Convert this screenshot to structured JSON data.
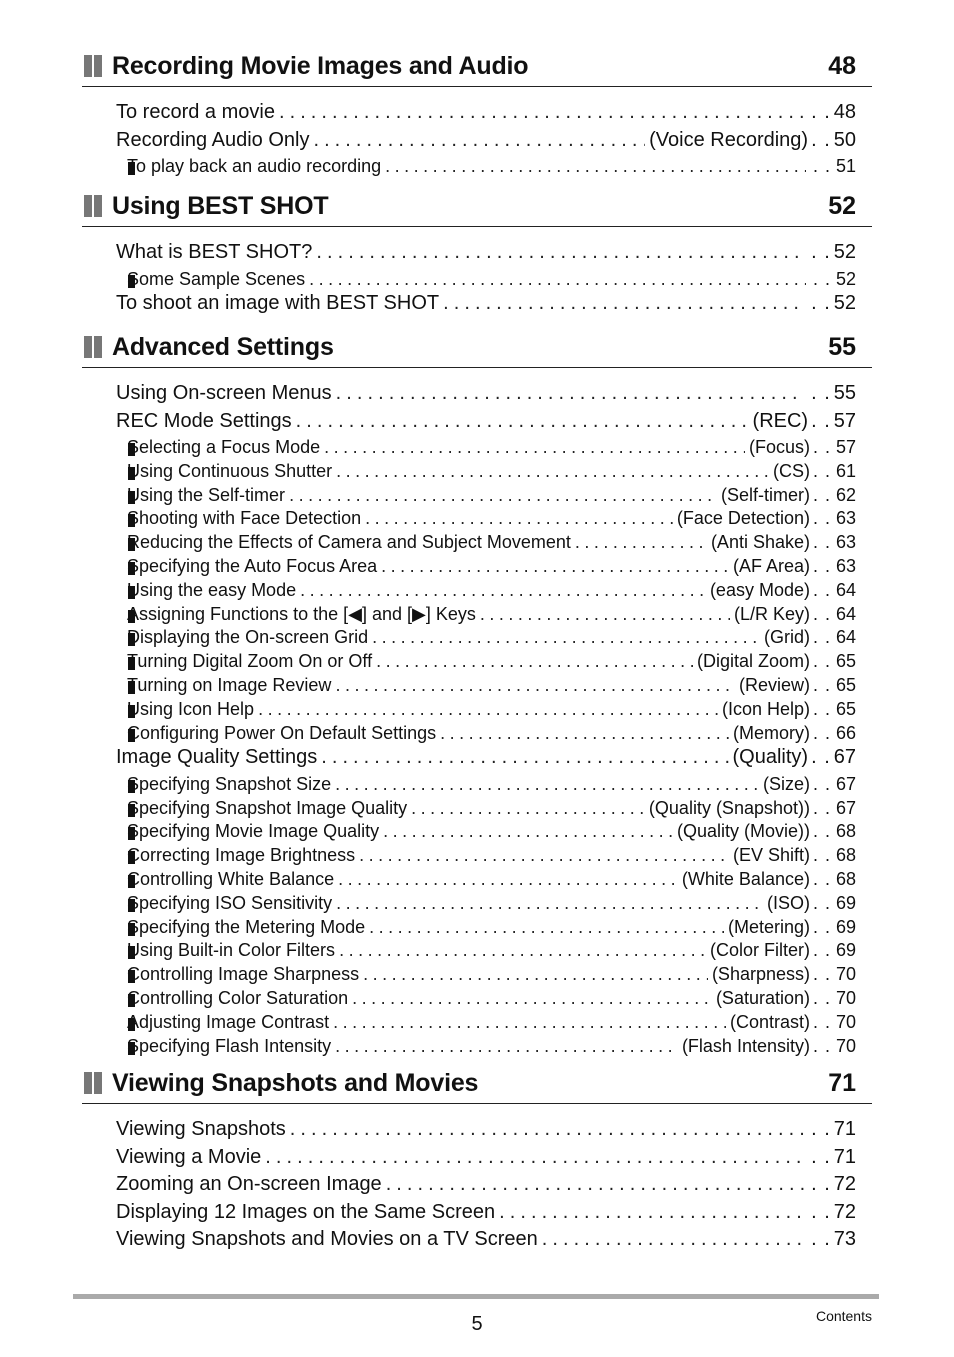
{
  "sections": [
    {
      "title": "Recording Movie Images and Audio",
      "page": "48",
      "entries": [
        {
          "level": 1,
          "label": "To record a movie",
          "tag": "",
          "page": "48"
        },
        {
          "level": 1,
          "label": "Recording Audio Only",
          "tag": "(Voice Recording)",
          "page": "50"
        },
        {
          "level": 2,
          "label": "To play back an audio recording",
          "tag": "",
          "page": "51"
        }
      ]
    },
    {
      "title": "Using BEST SHOT",
      "page": "52",
      "entries": [
        {
          "level": 1,
          "label": "What is BEST SHOT?",
          "tag": "",
          "page": "52"
        },
        {
          "level": 2,
          "label": "Some Sample Scenes",
          "tag": "",
          "page": "52"
        },
        {
          "level": 1,
          "label": "To shoot an image with BEST SHOT",
          "tag": "",
          "page": "52"
        }
      ]
    },
    {
      "title": "Advanced Settings",
      "page": "55",
      "entries": [
        {
          "level": 1,
          "label": "Using On-screen Menus",
          "tag": "",
          "page": "55"
        },
        {
          "level": 1,
          "label": "REC Mode Settings",
          "tag": "(REC)",
          "page": "57"
        },
        {
          "level": 2,
          "label": "Selecting a Focus Mode",
          "tag": "(Focus)",
          "page": "57"
        },
        {
          "level": 2,
          "label": "Using Continuous Shutter",
          "tag": "(CS)",
          "page": "61"
        },
        {
          "level": 2,
          "label": "Using the Self-timer",
          "tag": "(Self-timer)",
          "page": "62"
        },
        {
          "level": 2,
          "label": "Shooting with Face Detection",
          "tag": "(Face Detection)",
          "page": "63"
        },
        {
          "level": 2,
          "label": "Reducing the Effects of Camera and Subject Movement",
          "tag": "(Anti Shake)",
          "page": "63"
        },
        {
          "level": 2,
          "label": "Specifying the Auto Focus Area",
          "tag": "(AF Area)",
          "page": "63"
        },
        {
          "level": 2,
          "label": "Using the easy Mode",
          "tag": "(easy Mode)",
          "page": "64"
        },
        {
          "level": 2,
          "label": "Assigning Functions to the [◀] and [▶] Keys",
          "tag": "(L/R Key)",
          "page": "64"
        },
        {
          "level": 2,
          "label": "Displaying the On-screen Grid",
          "tag": "(Grid)",
          "page": "64"
        },
        {
          "level": 2,
          "label": "Turning Digital Zoom On or Off",
          "tag": "(Digital Zoom)",
          "page": "65"
        },
        {
          "level": 2,
          "label": "Turning on Image Review",
          "tag": "(Review)",
          "page": "65"
        },
        {
          "level": 2,
          "label": "Using Icon Help",
          "tag": "(Icon Help)",
          "page": "65"
        },
        {
          "level": 2,
          "label": "Configuring Power On Default Settings",
          "tag": "(Memory)",
          "page": "66"
        },
        {
          "level": 1,
          "label": "Image Quality Settings",
          "tag": "(Quality)",
          "page": "67"
        },
        {
          "level": 2,
          "label": "Specifying Snapshot Size",
          "tag": "(Size)",
          "page": "67"
        },
        {
          "level": 2,
          "label": "Specifying Snapshot Image Quality",
          "tag": "(Quality (Snapshot))",
          "page": "67"
        },
        {
          "level": 2,
          "label": "Specifying Movie Image Quality",
          "tag": "(Quality (Movie))",
          "page": "68"
        },
        {
          "level": 2,
          "label": "Correcting Image Brightness",
          "tag": "(EV Shift)",
          "page": "68"
        },
        {
          "level": 2,
          "label": "Controlling White Balance",
          "tag": "(White Balance)",
          "page": "68"
        },
        {
          "level": 2,
          "label": "Specifying ISO Sensitivity",
          "tag": "(ISO)",
          "page": "69"
        },
        {
          "level": 2,
          "label": "Specifying the Metering Mode",
          "tag": "(Metering)",
          "page": "69"
        },
        {
          "level": 2,
          "label": "Using Built-in Color Filters",
          "tag": "(Color Filter)",
          "page": "69"
        },
        {
          "level": 2,
          "label": "Controlling Image Sharpness",
          "tag": "(Sharpness)",
          "page": "70"
        },
        {
          "level": 2,
          "label": "Controlling Color Saturation",
          "tag": "(Saturation)",
          "page": "70"
        },
        {
          "level": 2,
          "label": "Adjusting Image Contrast",
          "tag": "(Contrast)",
          "page": "70"
        },
        {
          "level": 2,
          "label": "Specifying Flash Intensity",
          "tag": "(Flash Intensity)",
          "page": "70"
        }
      ]
    },
    {
      "title": "Viewing Snapshots and Movies",
      "page": "71",
      "entries": [
        {
          "level": 1,
          "label": "Viewing Snapshots",
          "tag": "",
          "page": "71"
        },
        {
          "level": 1,
          "label": "Viewing a Movie",
          "tag": "",
          "page": "71"
        },
        {
          "level": 1,
          "label": "Zooming an On-screen Image",
          "tag": "",
          "page": "72"
        },
        {
          "level": 1,
          "label": "Displaying 12 Images on the Same Screen",
          "tag": "",
          "page": "72"
        },
        {
          "level": 1,
          "label": "Viewing Snapshots and Movies on a TV Screen",
          "tag": "",
          "page": "73"
        }
      ]
    }
  ],
  "footer": {
    "page_number": "5",
    "label": "Contents"
  },
  "colors": {
    "heading_icon": "#777777",
    "footer_bar": "#aaaaaa",
    "text": "#111111"
  }
}
